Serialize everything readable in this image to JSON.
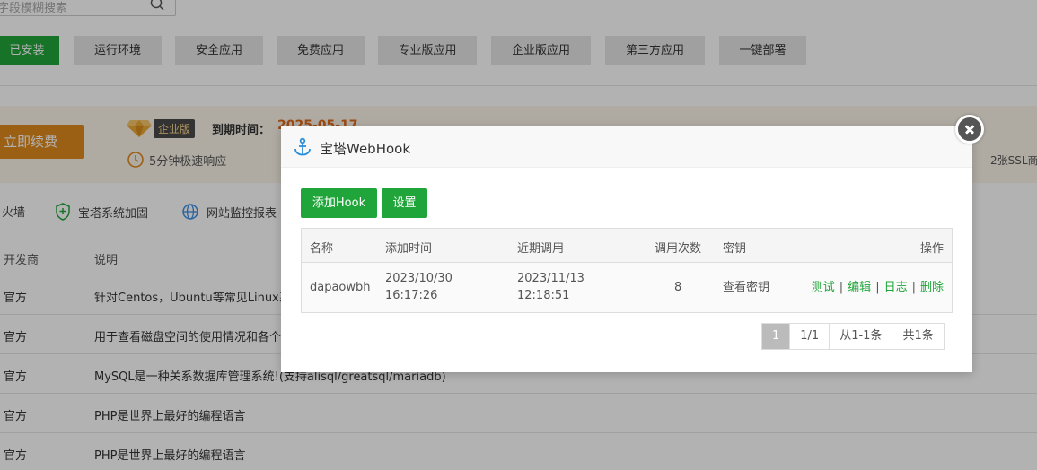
{
  "search": {
    "placeholder": "字段模糊搜索"
  },
  "tabs": [
    "已安装",
    "运行环境",
    "安全应用",
    "免费应用",
    "专业版应用",
    "企业版应用",
    "第三方应用",
    "一键部署"
  ],
  "banner": {
    "renew_label": "立即续费",
    "edition_label": "企业版",
    "expire_label": "到期时间：",
    "expire_value": "2025-05-17",
    "response_label": "5分钟极速响应",
    "ssl_label": "2张SSL商"
  },
  "quick_links": [
    "火墙",
    "宝塔系统加固",
    "网站监控报表"
  ],
  "table": {
    "headers": [
      "开发商",
      "说明"
    ],
    "rows": [
      {
        "vendor": "官方",
        "desc": "针对Centos，Ubuntu等常见Linux系"
      },
      {
        "vendor": "官方",
        "desc": "用于查看磁盘空间的使用情况和各个"
      },
      {
        "vendor": "官方",
        "desc": "MySQL是一种关系数据库管理系统!(支持alisql/greatsql/mariadb)"
      },
      {
        "vendor": "官方",
        "desc": "PHP是世界上最好的编程语言"
      },
      {
        "vendor": "官方",
        "desc": "PHP是世界上最好的编程语言"
      }
    ]
  },
  "dialog": {
    "title": "宝塔WebHook",
    "add_button": "添加Hook",
    "settings_button": "设置",
    "columns": {
      "name": "名称",
      "added": "添加时间",
      "recent": "近期调用",
      "count": "调用次数",
      "key": "密钥",
      "ops": "操作"
    },
    "hooks": [
      {
        "name": "dapaowbh",
        "added_date": "2023/10/30",
        "added_time": "16:17:26",
        "recent_date": "2023/11/13",
        "recent_time": "12:18:51",
        "count": "8",
        "key_link": "查看密钥",
        "op_test": "测试",
        "op_edit": "编辑",
        "op_log": "日志",
        "op_delete": "删除",
        "separator": "|"
      }
    ],
    "pagination": {
      "current": "1",
      "pages": "1/1",
      "range": "从1-1条",
      "total": "共1条"
    }
  },
  "colors": {
    "primary": "#20a53a",
    "accent": "#e08a1d"
  }
}
